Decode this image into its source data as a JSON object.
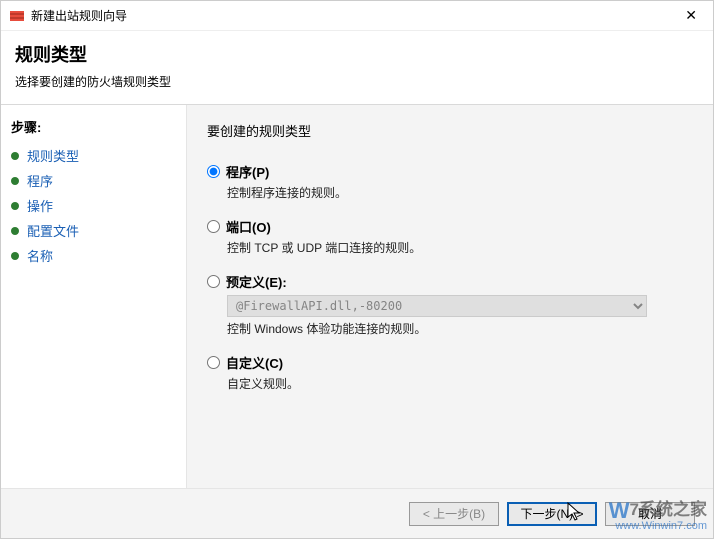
{
  "window": {
    "title": "新建出站规则向导"
  },
  "header": {
    "title": "规则类型",
    "subtitle": "选择要创建的防火墙规则类型"
  },
  "sidebar": {
    "steps_label": "步骤:",
    "items": [
      {
        "label": "规则类型"
      },
      {
        "label": "程序"
      },
      {
        "label": "操作"
      },
      {
        "label": "配置文件"
      },
      {
        "label": "名称"
      }
    ]
  },
  "content": {
    "prompt": "要创建的规则类型",
    "options": [
      {
        "label": "程序(P)",
        "desc": "控制程序连接的规则。",
        "checked": true
      },
      {
        "label": "端口(O)",
        "desc": "控制 TCP 或 UDP 端口连接的规则。",
        "checked": false
      },
      {
        "label": "预定义(E):",
        "desc": "控制 Windows 体验功能连接的规则。",
        "checked": false,
        "dropdown_value": "@FirewallAPI.dll,-80200"
      },
      {
        "label": "自定义(C)",
        "desc": "自定义规则。",
        "checked": false
      }
    ]
  },
  "footer": {
    "back": "< 上一步(B)",
    "next": "下一步(N) >",
    "cancel": "取消"
  },
  "watermark": {
    "brand_tail": "7系统之家",
    "url": "www.Winwin7.com"
  }
}
